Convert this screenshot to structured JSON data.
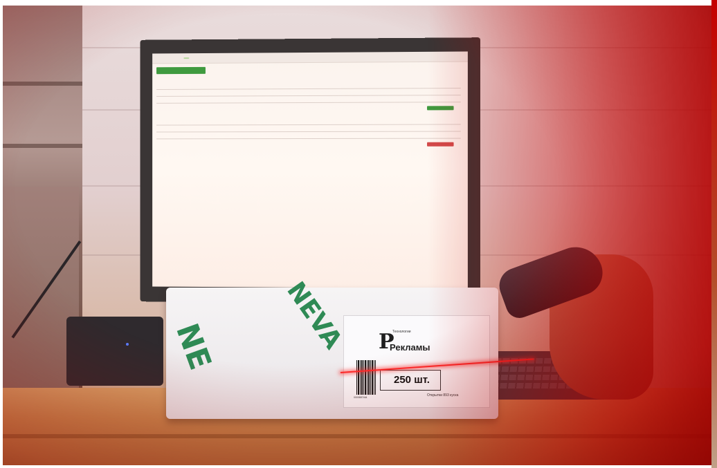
{
  "screen": {
    "nav_tabs": [
      "",
      "",
      "",
      ""
    ],
    "active_tab": "",
    "primary_button": "",
    "secondary_button": "",
    "sections": [
      "",
      ""
    ],
    "action_green": "",
    "action_red": ""
  },
  "package_label": {
    "brand_top": "Технологии",
    "brand_bottom": "Рекламы",
    "quantity": "250 шт.",
    "footer": "Открытки 893 куска",
    "barcode_number": "0000887464"
  },
  "package_print": {
    "word_1": "NE",
    "word_2": "NEVA"
  },
  "colors": {
    "accent_green": "#3f9a3f",
    "accent_red": "#d24a4a",
    "vignette_red": "#c40000"
  }
}
